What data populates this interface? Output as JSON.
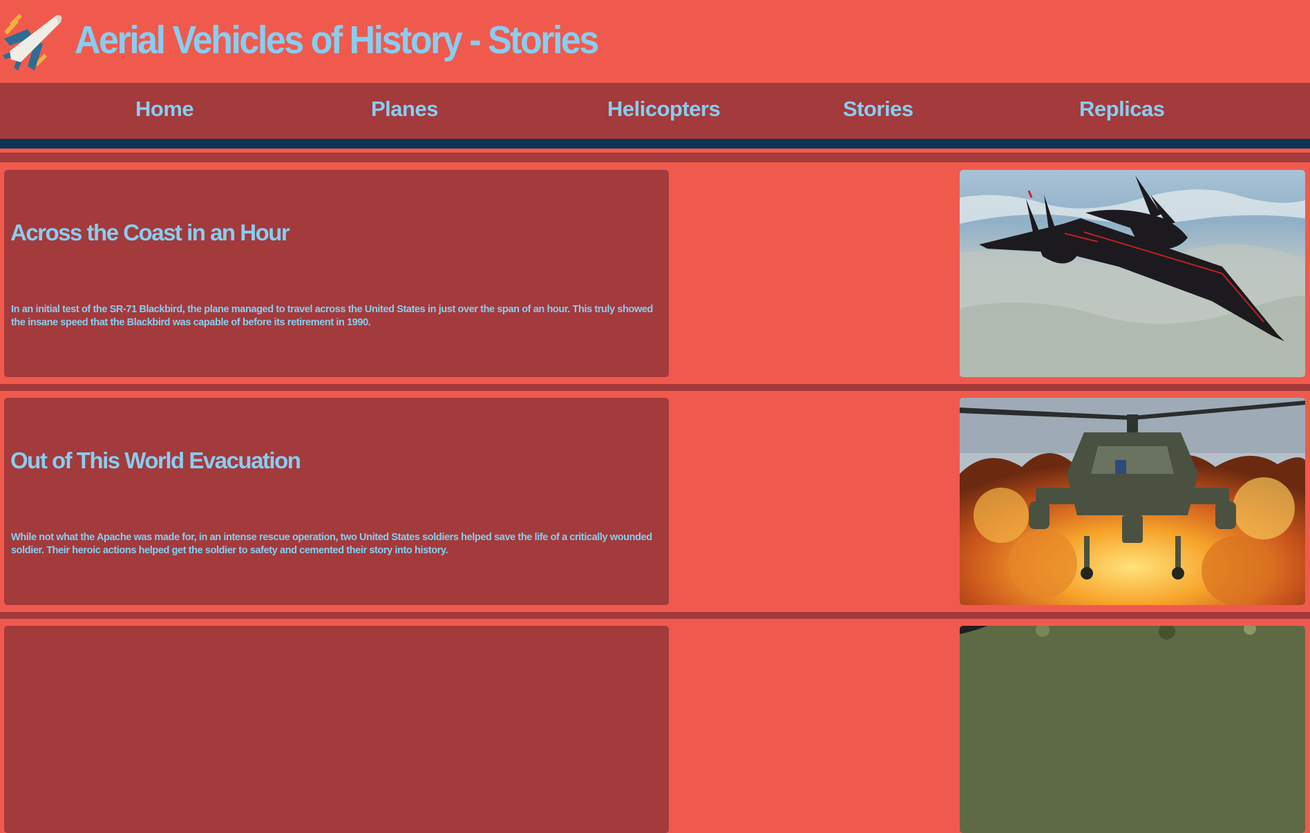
{
  "header": {
    "title": "Aerial Vehicles of History - Stories",
    "logo_icon": "airplane-icon"
  },
  "nav": {
    "items": [
      {
        "label": "Home"
      },
      {
        "label": "Planes"
      },
      {
        "label": "Helicopters"
      },
      {
        "label": "Stories"
      },
      {
        "label": "Replicas"
      }
    ]
  },
  "stories": [
    {
      "title": "Across the Coast in an Hour",
      "text": "In an initial test of the SR-71 Blackbird, the plane managed to travel across the United States in just over the span of an hour. This truly showed the insane speed that the Blackbird was capable of before its retirement in 1990.",
      "image": "sr71-blackbird-photo"
    },
    {
      "title": "Out of This World Evacuation",
      "text": "While not what the Apache was made for, in an intense rescue operation, two United States soldiers helped save the life of a critically wounded soldier. Their heroic actions helped get the soldier to safety and cemented their story into history.",
      "image": "apache-helicopter-explosion-photo"
    },
    {
      "title": "",
      "text": "",
      "image": "partial-story-photo"
    }
  ],
  "colors": {
    "background": "#f05a4d",
    "panel": "#a33a3c",
    "accent_text": "#87cef0",
    "nav_divider": "#0d3453"
  }
}
